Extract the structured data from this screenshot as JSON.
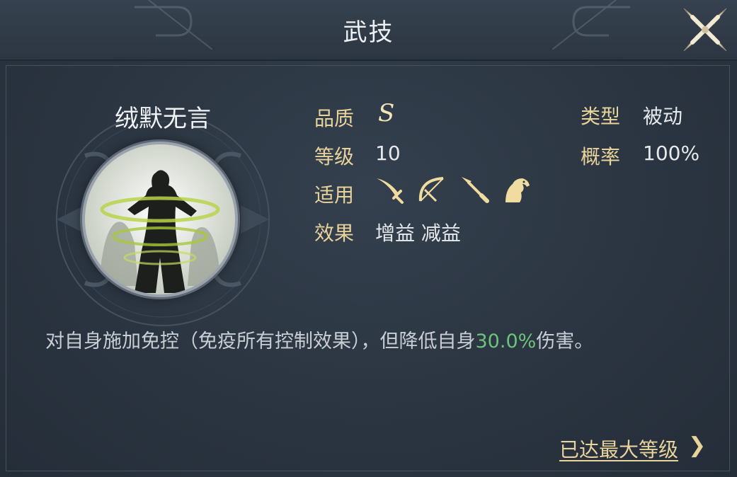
{
  "header": {
    "title": "武技"
  },
  "skill": {
    "name": "绒默无言",
    "icon": "silhouette-swirl-icon"
  },
  "attributes": {
    "quality_label": "品质",
    "quality_value": "S",
    "level_label": "等级",
    "level_value": "10",
    "applies_label": "适用",
    "applies_icons": [
      "sword-icon",
      "bow-icon",
      "spear-icon",
      "horse-icon"
    ],
    "effect_label": "效果",
    "effect_value": "增益 减益",
    "type_label": "类型",
    "type_value": "被动",
    "chance_label": "概率",
    "chance_value": "100%"
  },
  "description": {
    "before": "对自身施加免控（免疫所有控制效果），但降低自身",
    "highlight": "30.0%",
    "after": "伤害。"
  },
  "footer": {
    "max_level_text": "已达最大等级",
    "chevron": "❯"
  },
  "colors": {
    "label_gold": "#e8d39a",
    "highlight_green": "#6cc47c",
    "background": "#2a3441"
  }
}
